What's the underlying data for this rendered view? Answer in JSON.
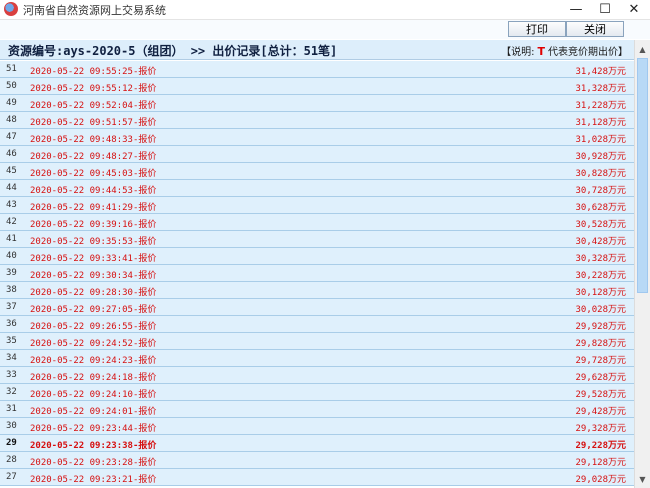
{
  "window": {
    "title": "河南省自然资源网上交易系统",
    "min_glyph": "—",
    "max_glyph": "☐",
    "close_glyph": "✕"
  },
  "toolbar": {
    "print_label": "打印",
    "close_label": "关闭"
  },
  "header": {
    "resource_line": "资源编号:ays-2020-5（组团） >> 出价记录[总计：51笔]",
    "legend_prefix": "【说明:",
    "legend_mark": "T",
    "legend_suffix": "代表竞价期出价】"
  },
  "bids": [
    {
      "no": "51",
      "time": "2020-05-22 09:55:25-报价",
      "price": "31,428万元"
    },
    {
      "no": "50",
      "time": "2020-05-22 09:55:12-报价",
      "price": "31,328万元"
    },
    {
      "no": "49",
      "time": "2020-05-22 09:52:04-报价",
      "price": "31,228万元"
    },
    {
      "no": "48",
      "time": "2020-05-22 09:51:57-报价",
      "price": "31,128万元"
    },
    {
      "no": "47",
      "time": "2020-05-22 09:48:33-报价",
      "price": "31,028万元"
    },
    {
      "no": "46",
      "time": "2020-05-22 09:48:27-报价",
      "price": "30,928万元"
    },
    {
      "no": "45",
      "time": "2020-05-22 09:45:03-报价",
      "price": "30,828万元"
    },
    {
      "no": "44",
      "time": "2020-05-22 09:44:53-报价",
      "price": "30,728万元"
    },
    {
      "no": "43",
      "time": "2020-05-22 09:41:29-报价",
      "price": "30,628万元"
    },
    {
      "no": "42",
      "time": "2020-05-22 09:39:16-报价",
      "price": "30,528万元"
    },
    {
      "no": "41",
      "time": "2020-05-22 09:35:53-报价",
      "price": "30,428万元"
    },
    {
      "no": "40",
      "time": "2020-05-22 09:33:41-报价",
      "price": "30,328万元"
    },
    {
      "no": "39",
      "time": "2020-05-22 09:30:34-报价",
      "price": "30,228万元"
    },
    {
      "no": "38",
      "time": "2020-05-22 09:28:30-报价",
      "price": "30,128万元"
    },
    {
      "no": "37",
      "time": "2020-05-22 09:27:05-报价",
      "price": "30,028万元"
    },
    {
      "no": "36",
      "time": "2020-05-22 09:26:55-报价",
      "price": "29,928万元"
    },
    {
      "no": "35",
      "time": "2020-05-22 09:24:52-报价",
      "price": "29,828万元"
    },
    {
      "no": "34",
      "time": "2020-05-22 09:24:23-报价",
      "price": "29,728万元"
    },
    {
      "no": "33",
      "time": "2020-05-22 09:24:18-报价",
      "price": "29,628万元"
    },
    {
      "no": "32",
      "time": "2020-05-22 09:24:10-报价",
      "price": "29,528万元"
    },
    {
      "no": "31",
      "time": "2020-05-22 09:24:01-报价",
      "price": "29,428万元"
    },
    {
      "no": "30",
      "time": "2020-05-22 09:23:44-报价",
      "price": "29,328万元"
    },
    {
      "no": "29",
      "time": "2020-05-22 09:23:38-报价",
      "price": "29,228万元",
      "highlight": true
    },
    {
      "no": "28",
      "time": "2020-05-22 09:23:28-报价",
      "price": "29,128万元"
    },
    {
      "no": "27",
      "time": "2020-05-22 09:23:21-报价",
      "price": "29,028万元"
    }
  ],
  "scrollbar": {
    "up_glyph": "▲",
    "down_glyph": "▼"
  }
}
